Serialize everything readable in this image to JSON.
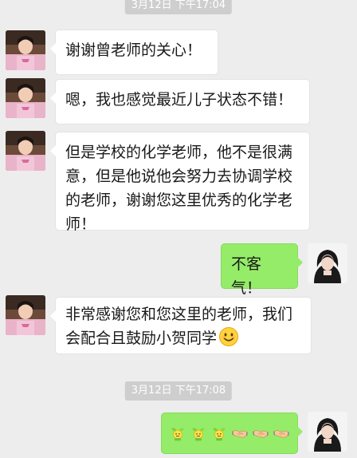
{
  "timestamps": [
    "3月12日 下午17:04",
    "3月12日 下午17:08"
  ],
  "messages": [
    {
      "sender": "other",
      "text": "谢谢曾老师的关心！"
    },
    {
      "sender": "other",
      "text": "嗯，我也感觉最近儿子状态不错！"
    },
    {
      "sender": "other",
      "text": "但是学校的化学老师，他不是很满意，但是他说他会努力去协调学校的老师，谢谢您这里优秀的化学老师！"
    },
    {
      "sender": "self",
      "text": "不客气！"
    },
    {
      "sender": "other",
      "text": "非常感谢您和您这里的老师，我们会配合且鼓励小贺同学",
      "emoji": "smile-emoji"
    },
    {
      "sender": "self",
      "emojis": [
        "sprout-emoji",
        "sprout-emoji",
        "sprout-emoji",
        "handshake-emoji",
        "handshake-emoji",
        "handshake-emoji"
      ]
    }
  ],
  "colors": {
    "background": "#ededed",
    "bubble_in": "#ffffff",
    "bubble_out": "#95ec69",
    "timestamp_bg": "#cecece"
  }
}
